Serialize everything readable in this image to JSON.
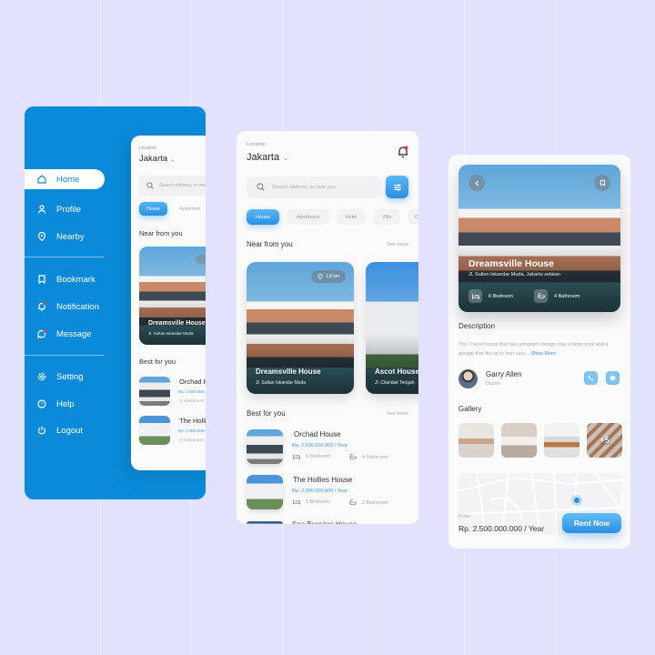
{
  "colors": {
    "background": "#e2e2fe",
    "primary": "#0a8ad8",
    "accent": "#2a8fe3",
    "price": "#3d9be9",
    "notification_dot": "#e53935"
  },
  "sidebar": {
    "items": [
      {
        "label": "Home",
        "icon": "home-icon",
        "active": true
      },
      {
        "label": "Profile",
        "icon": "user-icon",
        "active": false
      },
      {
        "label": "Nearby",
        "icon": "location-pin-icon",
        "active": false
      },
      {
        "label": "Bookmark",
        "icon": "bookmark-icon",
        "active": false
      },
      {
        "label": "Notification",
        "icon": "bell-icon",
        "active": false
      },
      {
        "label": "Message",
        "icon": "chat-icon",
        "active": false
      },
      {
        "label": "Setting",
        "icon": "gear-icon",
        "active": false
      },
      {
        "label": "Help",
        "icon": "help-icon",
        "active": false
      },
      {
        "label": "Logout",
        "icon": "power-icon",
        "active": false
      }
    ]
  },
  "home": {
    "location_label": "Location",
    "city": "Jakarta",
    "search_placeholder": "Search address, or near you",
    "categories": [
      "House",
      "Apartment",
      "Hotel",
      "Villa",
      "Cottage"
    ],
    "active_category": "House",
    "near_title": "Near from you",
    "best_title": "Best for you",
    "see_more": "See more",
    "near": [
      {
        "name": "Dreamsville House",
        "address": "Jl. Sultan Iskandar Muda",
        "distance": "1.8 km"
      },
      {
        "name": "Ascot House",
        "address": "Jl. Cilandak Tengah",
        "distance": ""
      }
    ],
    "best": [
      {
        "name": "Orchad House",
        "price": "Rp. 2.500.000.000 / Year",
        "bedrooms": "6 Bedroom",
        "bathrooms": "4 Bathroom"
      },
      {
        "name": "The Hollies House",
        "price": "Rp. 2.000.000.000 / Year",
        "bedrooms": "5 Bedroom",
        "bathrooms": "2 Bathroom"
      },
      {
        "name": "Sea Breezes House",
        "price": "",
        "bedrooms": "",
        "bathrooms": ""
      }
    ]
  },
  "detail": {
    "name": "Dreamsville House",
    "address": "Jl. Sultan Iskandar Muda, Jakarta selatan",
    "bedrooms": "6 Bedroom",
    "bathrooms": "4 Bathroom",
    "description_title": "Description",
    "description": "The 3 level house that has a modern design, has a large pool and a garage that fits up to four cars...",
    "show_more": "Show More",
    "owner_name": "Garry Allen",
    "owner_role": "Owner",
    "gallery_title": "Gallery",
    "gallery_more": "+5",
    "price_label": "Price",
    "price": "Rp. 2.500.000.000 / Year",
    "rent_button": "Rent Now"
  }
}
